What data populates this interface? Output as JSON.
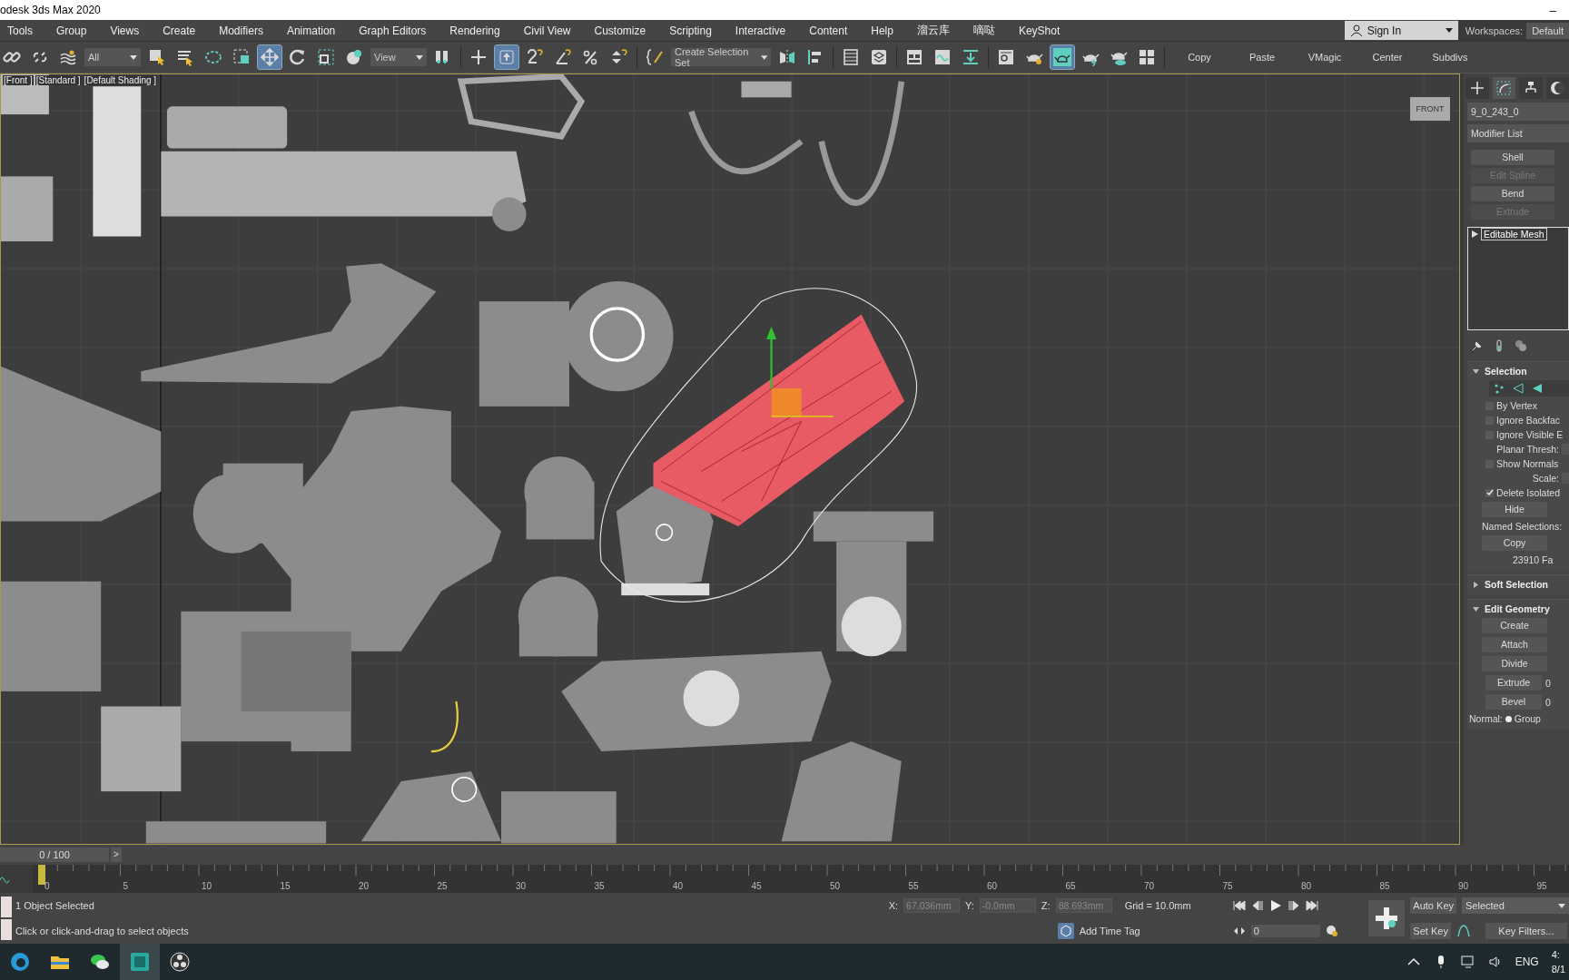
{
  "title_bar": {
    "title": "odesk 3ds Max 2020",
    "minimize": "–"
  },
  "menu": [
    "Tools",
    "Group",
    "Views",
    "Create",
    "Modifiers",
    "Animation",
    "Graph Editors",
    "Rendering",
    "Civil View",
    "Customize",
    "Scripting",
    "Interactive",
    "Content",
    "Help",
    "溜云库",
    "嘀哒",
    "KeyShot"
  ],
  "account": {
    "sign_in": "Sign In",
    "workspaces_label": "Workspaces:",
    "workspace": "Default"
  },
  "toolbar": {
    "filter": "All",
    "coord_system": "View",
    "selection_set": "Create Selection Set",
    "buttons": [
      {
        "selected": false
      },
      {
        "selected": false
      },
      {
        "selected": false
      },
      {
        "selected": false
      },
      {
        "selected": false
      },
      {
        "selected": false
      },
      {
        "selected": false
      },
      {
        "selected": true
      },
      {
        "selected": false
      },
      {
        "selected": false
      },
      {
        "selected": false
      },
      {
        "selected": false
      },
      {
        "selected": false
      },
      {
        "selected": true
      },
      {
        "selected": false
      },
      {
        "selected": false
      },
      {
        "selected": false
      },
      {
        "selected": false
      },
      {
        "selected": false
      },
      {
        "selected": false
      },
      {
        "selected": false
      },
      {
        "selected": false
      },
      {
        "selected": false
      },
      {
        "selected": false
      },
      {
        "selected": false
      },
      {
        "selected": false
      },
      {
        "selected": false
      },
      {
        "selected": false
      },
      {
        "selected": true
      },
      {
        "selected": false
      },
      {
        "selected": false
      },
      {
        "selected": false
      }
    ],
    "scripts": [
      "Copy",
      "Paste",
      "VMagic",
      "Center",
      "Subdivs"
    ]
  },
  "viewport": {
    "labels": [
      "[Front ]",
      "[Standard ]",
      "[Default Shading ]"
    ],
    "viewcube": "FRONT"
  },
  "command_panel": {
    "tabs": [
      {
        "selected": false
      },
      {
        "selected": true
      },
      {
        "selected": false
      },
      {
        "selected": false
      }
    ],
    "object_name": "9_0_243_0",
    "modifier_list": "Modifier List",
    "modifier_buttons": [
      {
        "label": "Shell",
        "disabled": false
      },
      {
        "label": "Edit Spline",
        "disabled": true
      },
      {
        "label": "Bend",
        "disabled": false
      },
      {
        "label": "Extrude",
        "disabled": true
      }
    ],
    "stack": [
      {
        "label": "Editable Mesh",
        "selected": true
      }
    ],
    "rollouts": [
      {
        "title": "Selection",
        "expanded": true,
        "items": [
          {
            "kind": "checkbox",
            "label": "By Vertex",
            "checked": false
          },
          {
            "kind": "checkbox",
            "label": "Ignore Backfac",
            "checked": false
          },
          {
            "kind": "checkbox",
            "label": "Ignore Visible E",
            "checked": false
          },
          {
            "kind": "field",
            "label": "Planar Thresh:"
          },
          {
            "kind": "checkbox",
            "label": "Show Normals",
            "checked": false
          },
          {
            "kind": "field",
            "label": "Scale:"
          },
          {
            "kind": "checkbox",
            "label": "Delete Isolated",
            "checked": true
          },
          {
            "kind": "button",
            "label": "Hide"
          },
          {
            "kind": "text",
            "label": "Named Selections:"
          },
          {
            "kind": "button",
            "label": "Copy"
          },
          {
            "kind": "info",
            "label": "23910 Fa"
          }
        ]
      },
      {
        "title": "Soft Selection",
        "expanded": false
      },
      {
        "title": "Edit Geometry",
        "expanded": true,
        "items": [
          {
            "kind": "button",
            "label": "Create"
          },
          {
            "kind": "button",
            "label": "Attach"
          },
          {
            "kind": "button",
            "label": "Divide"
          },
          {
            "kind": "spinner",
            "label": "Extrude",
            "value": "0"
          },
          {
            "kind": "spinner",
            "label": "Bevel",
            "value": "0"
          },
          {
            "kind": "radio",
            "label": "Normal:",
            "option": "Group",
            "selected": true
          }
        ]
      }
    ]
  },
  "timeline": {
    "position": "0 / 100",
    "next": ">",
    "ticks": [
      "0",
      "5",
      "10",
      "15",
      "20",
      "25",
      "30",
      "35",
      "40",
      "45",
      "50",
      "55",
      "60",
      "65",
      "70",
      "75",
      "80",
      "85",
      "90",
      "95"
    ]
  },
  "status": {
    "selection": "1 Object Selected",
    "prompt": "Click or click-and-drag to select objects",
    "coords": [
      {
        "label": "X:",
        "value": "67.036mm",
        "disabled": true
      },
      {
        "label": "Y:",
        "value": "-0.0mm",
        "disabled": true
      },
      {
        "label": "Z:",
        "value": "88.693mm",
        "disabled": true
      }
    ],
    "grid": "Grid = 10.0mm",
    "time_tag": "Add Time Tag",
    "frame": "0",
    "auto_key": "Auto Key",
    "key_set": "Selected",
    "set_key": "Set Key",
    "key_filters": "Key Filters..."
  },
  "taskbar": {
    "apps": [
      {
        "selected": false
      },
      {
        "selected": false
      },
      {
        "selected": false
      },
      {
        "selected": true
      },
      {
        "selected": false
      }
    ],
    "language": "ENG",
    "time": "4:",
    "date": "8/1"
  }
}
